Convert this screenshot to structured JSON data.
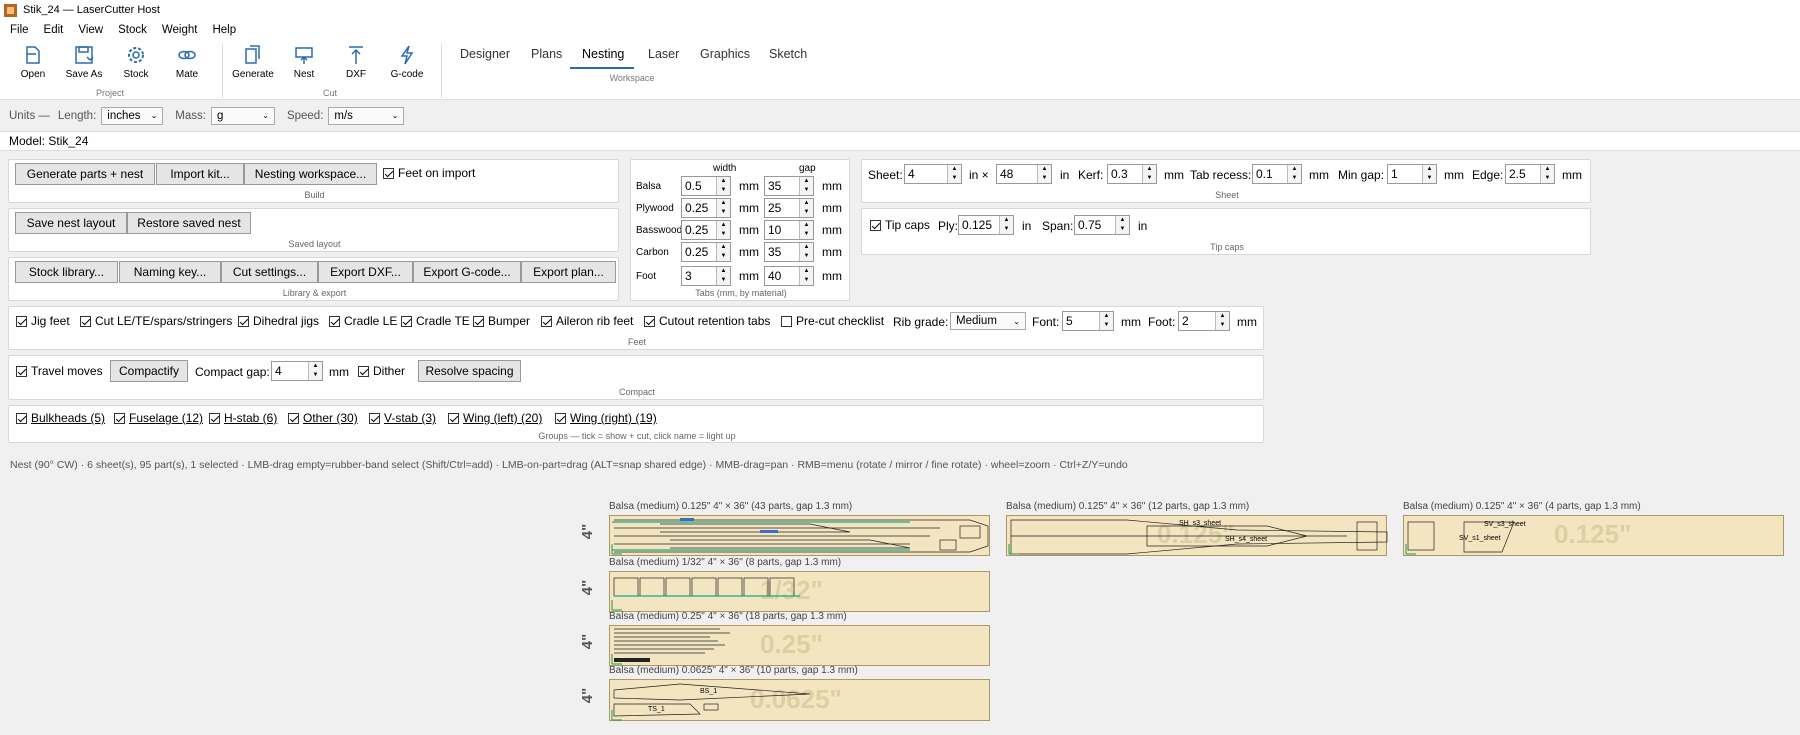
{
  "window": {
    "title": "Stik_24 — LaserCutter Host"
  },
  "menu": [
    "File",
    "Edit",
    "View",
    "Stock",
    "Weight",
    "Help"
  ],
  "toolbar": {
    "project": [
      {
        "label": "Open",
        "icon": "open-file-icon"
      },
      {
        "label": "Save As",
        "icon": "save-icon"
      },
      {
        "label": "Stock",
        "icon": "gear-icon"
      },
      {
        "label": "Mate",
        "icon": "link-icon"
      }
    ],
    "project_group": "Project",
    "cut": [
      {
        "label": "Generate",
        "icon": "copy-icon"
      },
      {
        "label": "Nest",
        "icon": "nest-icon"
      },
      {
        "label": "DXF",
        "icon": "upload-arrow-icon"
      },
      {
        "label": "G-code",
        "icon": "lightning-icon"
      }
    ],
    "cut_group": "Cut",
    "workspace_tabs": [
      "Designer",
      "Plans",
      "Nesting",
      "Laser",
      "Graphics",
      "Sketch"
    ],
    "active_tab": "Nesting",
    "workspace_group": "Workspace"
  },
  "units": {
    "prefix": "Units —",
    "length_label": "Length:",
    "length": "inches",
    "mass_label": "Mass:",
    "mass": "g",
    "speed_label": "Speed:",
    "speed": "m/s"
  },
  "model": {
    "label": "Model: Stik_24"
  },
  "build": {
    "generate": "Generate parts + nest",
    "import": "Import kit...",
    "workspace": "Nesting workspace...",
    "feet_on_import": "Feet on import",
    "group": "Build"
  },
  "saved": {
    "save": "Save nest layout",
    "restore": "Restore saved nest",
    "group": "Saved layout"
  },
  "library": {
    "buttons": [
      "Stock library...",
      "Naming key...",
      "Cut settings...",
      "Export DXF...",
      "Export G-code...",
      "Export plan..."
    ],
    "group": "Library & export"
  },
  "tabs": {
    "width_hdr": "width",
    "gap_hdr": "gap",
    "unit": "mm",
    "rows": [
      {
        "name": "Balsa",
        "width": "0.5",
        "gap": "35"
      },
      {
        "name": "Plywood",
        "width": "0.25",
        "gap": "25"
      },
      {
        "name": "Basswood",
        "width": "0.25",
        "gap": "10"
      },
      {
        "name": "Carbon",
        "width": "0.25",
        "gap": "35"
      },
      {
        "name": "Foot",
        "width": "3",
        "gap": "40"
      }
    ],
    "group": "Tabs (mm, by material)"
  },
  "sheet": {
    "sheet_label": "Sheet:",
    "w": "4",
    "x": "in ×",
    "h": "48",
    "in": "in",
    "kerf_label": "Kerf:",
    "kerf": "0.3",
    "mm": "mm",
    "recess_label": "Tab recess:",
    "recess": "0.1",
    "mingap_label": "Min gap:",
    "mingap": "1",
    "edge_label": "Edge:",
    "edge": "2.5",
    "group": "Sheet"
  },
  "tipcaps": {
    "toggle": "Tip caps",
    "ply_label": "Ply:",
    "ply": "0.125",
    "in": "in",
    "span_label": "Span:",
    "span": "0.75",
    "group": "Tip caps"
  },
  "feet": {
    "checks": [
      "Jig feet",
      "Cut LE/TE/spars/stringers",
      "Dihedral jigs",
      "Cradle LE",
      "Cradle TE",
      "Bumper",
      "Aileron rib feet",
      "Cutout retention tabs"
    ],
    "precut": "Pre-cut checklist",
    "rib_label": "Rib grade:",
    "rib": "Medium",
    "font_label": "Font:",
    "font": "5",
    "mm": "mm",
    "foot_label": "Foot:",
    "foot": "2",
    "group": "Feet"
  },
  "compact": {
    "travel": "Travel moves",
    "compactify": "Compactify",
    "gap_label": "Compact gap:",
    "gap": "4",
    "mm": "mm",
    "dither": "Dither",
    "resolve": "Resolve spacing",
    "group": "Compact"
  },
  "groups": {
    "items": [
      "Bulkheads (5)",
      "Fuselage (12)",
      "H-stab (6)",
      "Other (30)",
      "V-stab (3)",
      "Wing (left) (20)",
      "Wing (right) (19)"
    ],
    "caption": "Groups — tick = show + cut, click name = light up"
  },
  "status": "Nest (90° CW)  ·  6 sheet(s), 95 part(s), 1 selected  ·  LMB-drag empty=rubber-band select (Shift/Ctrl=add) · LMB-on-part=drag (ALT=snap shared edge) · MMB-drag=pan · RMB=menu (rotate / mirror / fine rotate) · wheel=zoom · Ctrl+Z/Y=undo",
  "sheets": [
    {
      "label": "Balsa (medium)  0.125\"   4\" × 36\"   (43 parts, gap 1.3 mm)",
      "wm": "",
      "side": "4\""
    },
    {
      "label": "Balsa (medium)  0.125\"   4\" × 36\"   (12 parts, gap 1.3 mm)",
      "wm": "0.125\"",
      "parts": [
        "SH_s3_sheet",
        "SH_s4_sheet"
      ]
    },
    {
      "label": "Balsa (medium)  0.125\"   4\" × 36\"   (4 parts, gap 1.3 mm)",
      "wm": "0.125\"",
      "parts": [
        "SV_s3_sheet",
        "SV_s1_sheet"
      ]
    },
    {
      "label": "Balsa (medium)  1/32\"   4\" × 36\"   (8 parts, gap 1.3 mm)",
      "wm": "1/32\"",
      "side": "4\""
    },
    {
      "label": "Balsa (medium)  0.25\"   4\" × 36\"   (18 parts, gap 1.3 mm)",
      "wm": "0.25\"",
      "side": "4\""
    },
    {
      "label": "Balsa (medium)  0.0625\"   4\" × 36\"   (10 parts, gap 1.3 mm)",
      "wm": "0.0625\"",
      "side": "4\"",
      "parts": [
        "BS_1",
        "TS_1"
      ]
    }
  ]
}
